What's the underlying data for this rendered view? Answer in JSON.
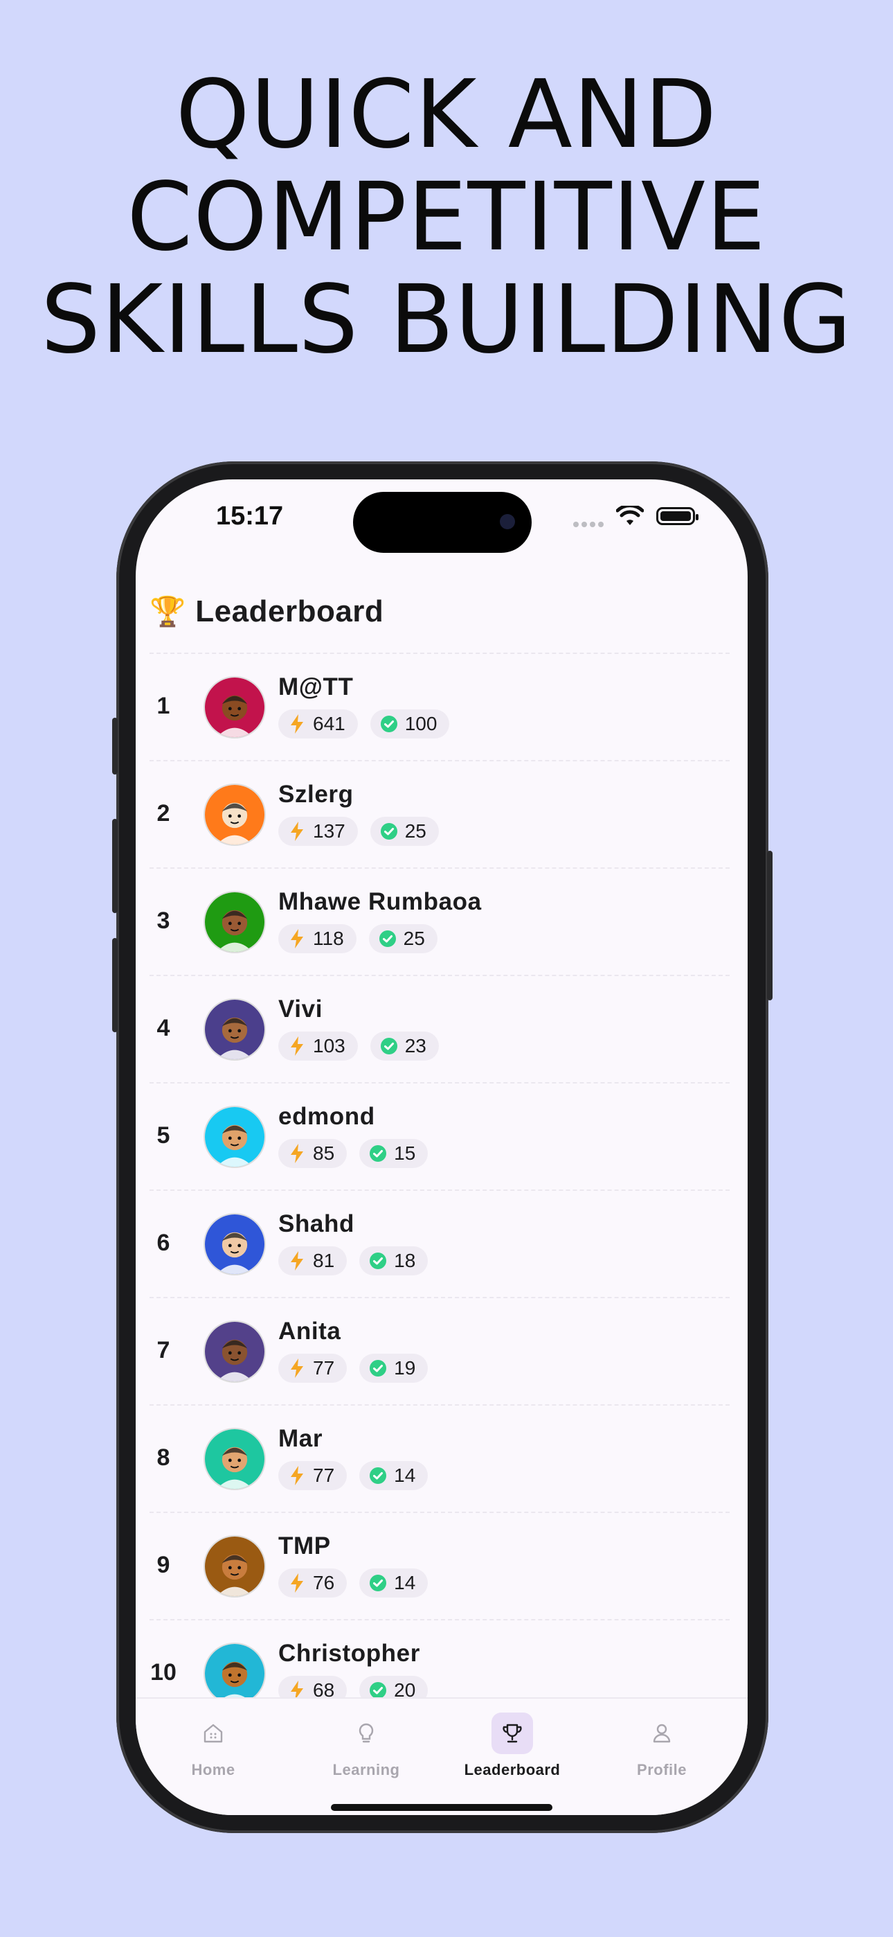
{
  "headline": [
    "QUICK AND",
    "COMPETITIVE",
    "SKILLS BUILDING"
  ],
  "status_bar": {
    "time": "15:17"
  },
  "leaderboard": {
    "icon": "trophy-icon",
    "emoji": "🏆",
    "title": "Leaderboard",
    "rows": [
      {
        "rank": "1",
        "name": "M@TT",
        "xp": "641",
        "done": "100",
        "avatar_bg": "#c2134c",
        "skin": "#8a4b22"
      },
      {
        "rank": "2",
        "name": "Szlerg",
        "xp": "137",
        "done": "25",
        "avatar_bg": "#ff7a1a",
        "skin": "#f6e1c8"
      },
      {
        "rank": "3",
        "name": "Mhawe Rumbaoa",
        "xp": "118",
        "done": "25",
        "avatar_bg": "#1f9b12",
        "skin": "#9a5a34"
      },
      {
        "rank": "4",
        "name": "Vivi",
        "xp": "103",
        "done": "23",
        "avatar_bg": "#4b3f8c",
        "skin": "#a76a3d"
      },
      {
        "rank": "5",
        "name": "edmond",
        "xp": "85",
        "done": "15",
        "avatar_bg": "#18c9f2",
        "skin": "#e0a26a"
      },
      {
        "rank": "6",
        "name": "Shahd",
        "xp": "81",
        "done": "18",
        "avatar_bg": "#2f56d8",
        "skin": "#f0c9a5"
      },
      {
        "rank": "7",
        "name": "Anita",
        "xp": "77",
        "done": "19",
        "avatar_bg": "#53418a",
        "skin": "#8a5330"
      },
      {
        "rank": "8",
        "name": "Mar",
        "xp": "77",
        "done": "14",
        "avatar_bg": "#1ec7a0",
        "skin": "#e2a571"
      },
      {
        "rank": "9",
        "name": "TMP",
        "xp": "76",
        "done": "14",
        "avatar_bg": "#9a5a12",
        "skin": "#c97d3e"
      },
      {
        "rank": "10",
        "name": "Christopher",
        "xp": "68",
        "done": "20",
        "avatar_bg": "#22b7d6",
        "skin": "#c0742e"
      }
    ]
  },
  "colors": {
    "accent": "#e8ddf6",
    "bolt": "#f5a623",
    "check": "#2fcf86",
    "background": "#d2d8fc"
  },
  "tabs": [
    {
      "label": "Home",
      "icon": "home-icon",
      "active": false
    },
    {
      "label": "Learning",
      "icon": "lightbulb-icon",
      "active": false
    },
    {
      "label": "Leaderboard",
      "icon": "trophy-icon",
      "active": true
    },
    {
      "label": "Profile",
      "icon": "user-icon",
      "active": false
    }
  ]
}
